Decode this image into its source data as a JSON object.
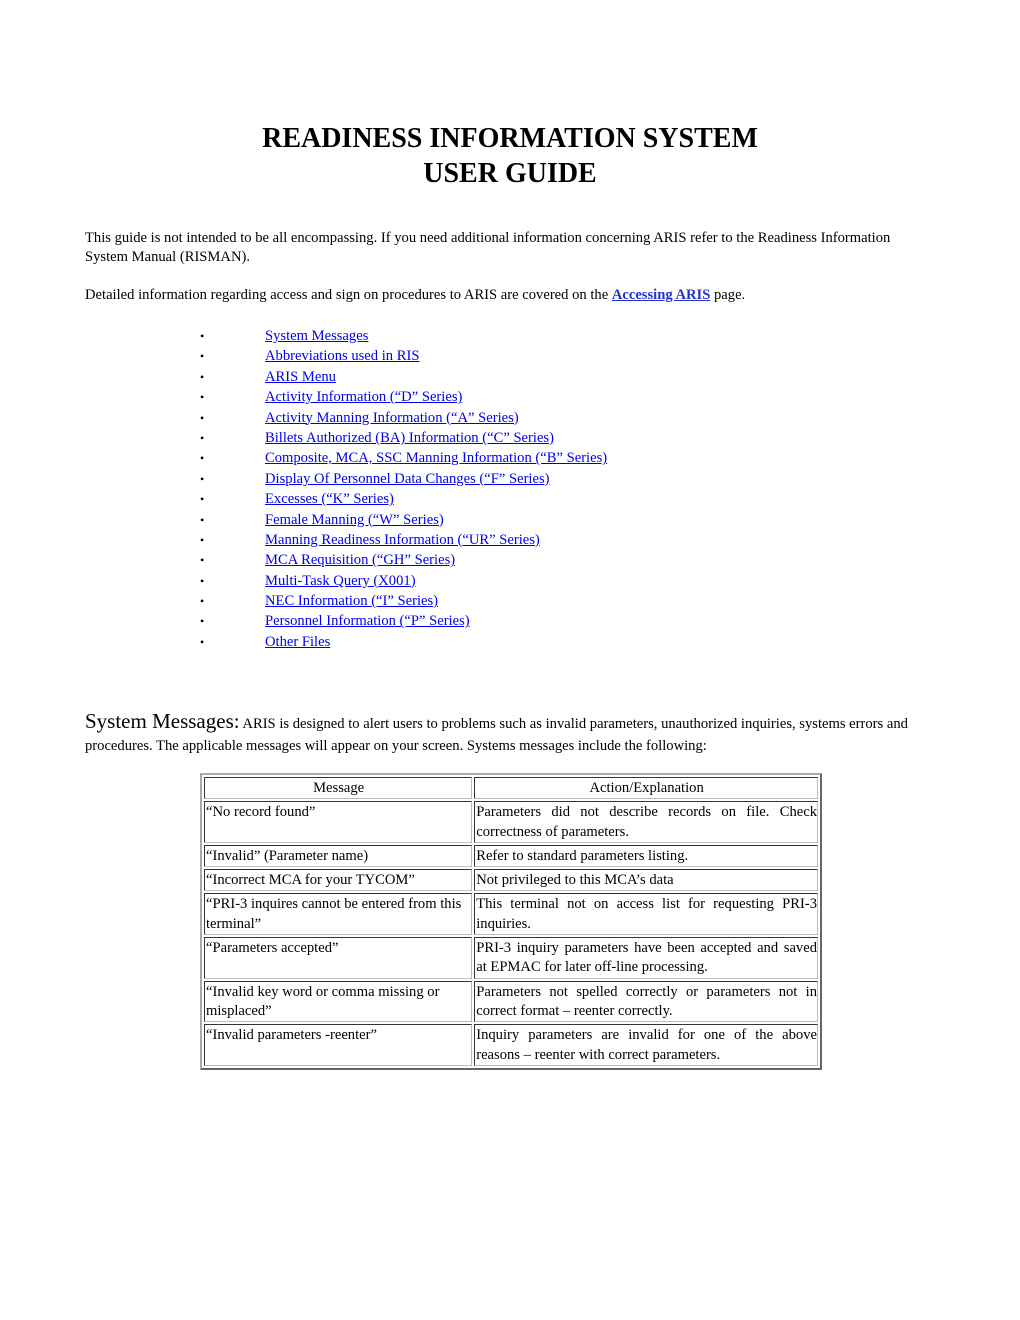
{
  "document": {
    "title_line1": "READINESS INFORMATION SYSTEM",
    "title_line2": "USER GUIDE",
    "intro": {
      "paragraph1": "This guide is not intended to be all encompassing.  If you need additional information concerning ARIS refer to the Readiness Information System Manual (RISMAN).",
      "paragraph2_before": "Detailed information regarding access and sign on procedures to ARIS are covered on the ",
      "paragraph2_link": "Accessing ARIS",
      "paragraph2_after": " page."
    },
    "toc": {
      "bullet": "•",
      "items": [
        "System Messages",
        "Abbreviations used in RIS",
        "ARIS Menu",
        "Activity Information (“D” Series)",
        "Activity Manning Information (“A” Series)",
        "Billets Authorized (BA) Information (“C” Series)",
        "Composite, MCA, SSC Manning Information (“B” Series)",
        "Display Of Personnel Data Changes (“F” Series)",
        "Excesses (“K” Series)",
        "Female Manning (“W” Series)",
        "Manning Readiness Information (“UR” Series)",
        "MCA Requisition (“GH” Series)",
        "Multi-Task Query (X001)",
        "NEC Information (“I” Series)",
        "Personnel Information (“P” Series)",
        "Other Files"
      ]
    },
    "system_messages": {
      "heading": "System Messages:",
      "text": "  ARIS is designed to alert users to problems such as invalid parameters, unauthorized inquiries, systems errors and procedures.  The applicable messages will appear on your screen.  Systems messages include the following:",
      "table": {
        "headers": [
          "Message",
          "Action/Explanation"
        ],
        "rows": [
          [
            "“No record found”",
            "Parameters did not describe records on file.  Check correctness of parameters."
          ],
          [
            "“Invalid” (Parameter name)",
            "Refer to standard parameters listing."
          ],
          [
            "“Incorrect MCA for your TYCOM”",
            "Not privileged to this MCA’s data"
          ],
          [
            "“PRI-3 inquires cannot be entered from this terminal”",
            "This terminal not on access list for requesting PRI-3 inquiries."
          ],
          [
            "“Parameters accepted”",
            "PRI-3 inquiry parameters have been accepted and saved at EPMAC for later off-line processing."
          ],
          [
            "“Invalid key word or comma missing or misplaced”",
            "Parameters not spelled correctly or parameters not in correct format – reenter correctly."
          ],
          [
            "“Invalid parameters -reenter”",
            "Inquiry parameters are invalid for one of the above reasons – reenter with correct parameters."
          ]
        ]
      }
    }
  }
}
